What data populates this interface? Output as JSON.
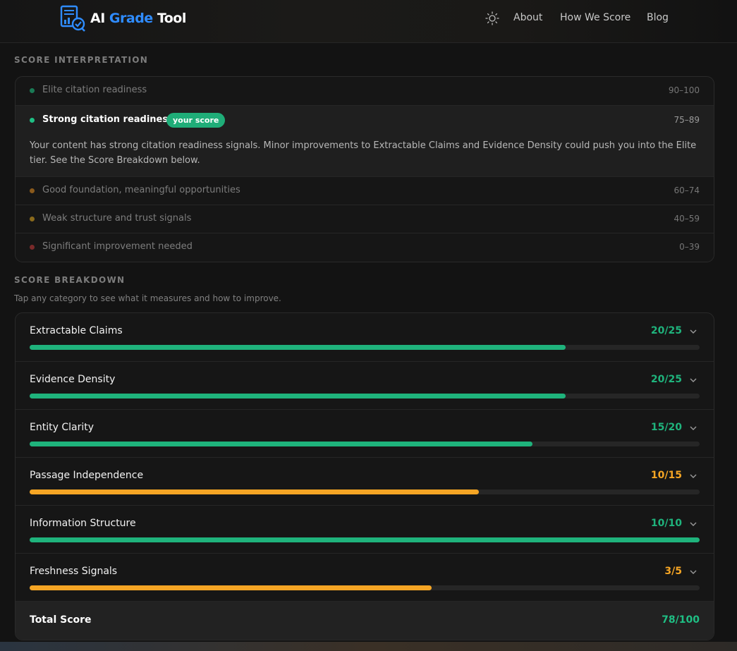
{
  "header": {
    "brand": {
      "w1": "AI",
      "w2": "Grade",
      "w3": "Tool"
    },
    "theme_toggle_icon": "sun-icon",
    "nav": [
      "About",
      "How We Score",
      "Blog"
    ]
  },
  "interpretation": {
    "title": "SCORE INTERPRETATION",
    "tiers": [
      {
        "label": "Elite citation readiness",
        "range": "90–100",
        "dot_color": "#1a7a55"
      },
      {
        "label": "Strong citation readiness",
        "range": "75–89",
        "dot_color": "#1fbf84",
        "badge": "your score",
        "description": "Your content has strong citation readiness signals. Minor improvements to Extractable Claims and Evidence Density could push you into the Elite tier. See the Score Breakdown below."
      },
      {
        "label": "Good foundation, meaningful opportunities",
        "range": "60–74",
        "dot_color": "#8a5a1c"
      },
      {
        "label": "Weak structure and trust signals",
        "range": "40–59",
        "dot_color": "#8a6a1c"
      },
      {
        "label": "Significant improvement needed",
        "range": "0–39",
        "dot_color": "#7a2a2a"
      }
    ]
  },
  "breakdown": {
    "title": "SCORE BREAKDOWN",
    "subtitle": "Tap any category to see what it measures and how to improve.",
    "categories": [
      {
        "name": "Extractable Claims",
        "score": "20/25",
        "fraction": 0.8,
        "color": "#1fb37c"
      },
      {
        "name": "Evidence Density",
        "score": "20/25",
        "fraction": 0.8,
        "color": "#1fb37c"
      },
      {
        "name": "Entity Clarity",
        "score": "15/20",
        "fraction": 0.75,
        "color": "#1fb37c"
      },
      {
        "name": "Passage Independence",
        "score": "10/15",
        "fraction": 0.67,
        "color": "#f5a524"
      },
      {
        "name": "Information Structure",
        "score": "10/10",
        "fraction": 1.0,
        "color": "#1fb37c"
      },
      {
        "name": "Freshness Signals",
        "score": "3/5",
        "fraction": 0.6,
        "color": "#f5a524"
      }
    ],
    "total_label": "Total Score",
    "total_score": "78/100"
  },
  "colors": {
    "accent_green": "#1fbf84",
    "accent_orange": "#f5a524",
    "brand_blue": "#2f8cff"
  }
}
